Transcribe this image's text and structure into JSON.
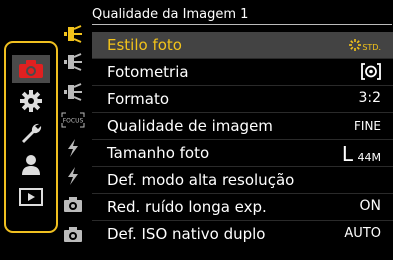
{
  "title": "Qualidade da Imagem 1",
  "menu": {
    "items": [
      {
        "label": "Estilo foto",
        "value": "STD."
      },
      {
        "label": "Fotometria",
        "value": ""
      },
      {
        "label": "Formato",
        "value": "3:2"
      },
      {
        "label": "Qualidade de imagem",
        "value": "FINE"
      },
      {
        "label": "Tamanho foto",
        "value_big": "L",
        "value_small": "44M"
      },
      {
        "label": "Def. modo alta resolução",
        "value": ""
      },
      {
        "label": "Red. ruído longa exp.",
        "value": "ON"
      },
      {
        "label": "Def. ISO nativo duplo",
        "value": "AUTO"
      }
    ]
  },
  "subtabs": {
    "focus_label": "FOCUS"
  },
  "colors": {
    "accent": "#f2c31b",
    "highlight_bg": "#434343",
    "camera_tab": "#e02020",
    "tab_border": "#f0c020"
  },
  "icons": {
    "main_tabs": [
      "camera-icon",
      "gear-icon",
      "wrench-icon",
      "person-icon",
      "playback-icon"
    ],
    "subtabs": [
      "photo-style-icon",
      "photo-style-icon",
      "photo-style-icon",
      "focus-icon",
      "flash-icon",
      "flash-icon",
      "camera-small-icon",
      "camera-small-icon"
    ]
  }
}
